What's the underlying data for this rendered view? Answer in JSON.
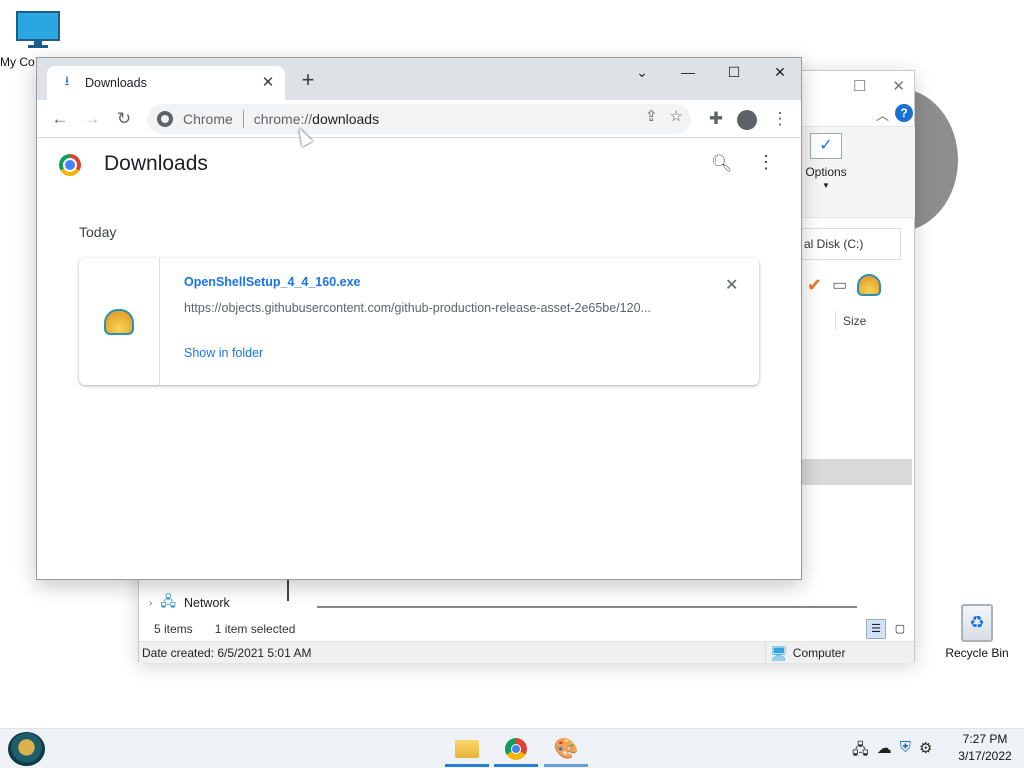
{
  "desktop": {
    "my_computer_label": "My Co",
    "recycle_bin_label": "Recycle Bin"
  },
  "explorer": {
    "options_label": "Options",
    "address_text": "al Disk (C:)",
    "size_col": "Size",
    "network_label": "Network",
    "items_count": "5 items",
    "items_selected": "1 item selected",
    "date_created": "Date created: 6/5/2021 5:01 AM",
    "location": "Computer"
  },
  "chrome": {
    "tab_title": "Downloads",
    "omnibox": {
      "site": "Chrome",
      "url_scheme": "chrome://",
      "url_path": "downloads"
    },
    "page_title": "Downloads",
    "day_label": "Today",
    "download": {
      "filename": "OpenShellSetup_4_4_160.exe",
      "url": "https://objects.githubusercontent.com/github-production-release-asset-2e65be/120...",
      "action": "Show in folder"
    }
  },
  "taskbar": {
    "time": "7:27 PM",
    "date": "3/17/2022"
  }
}
